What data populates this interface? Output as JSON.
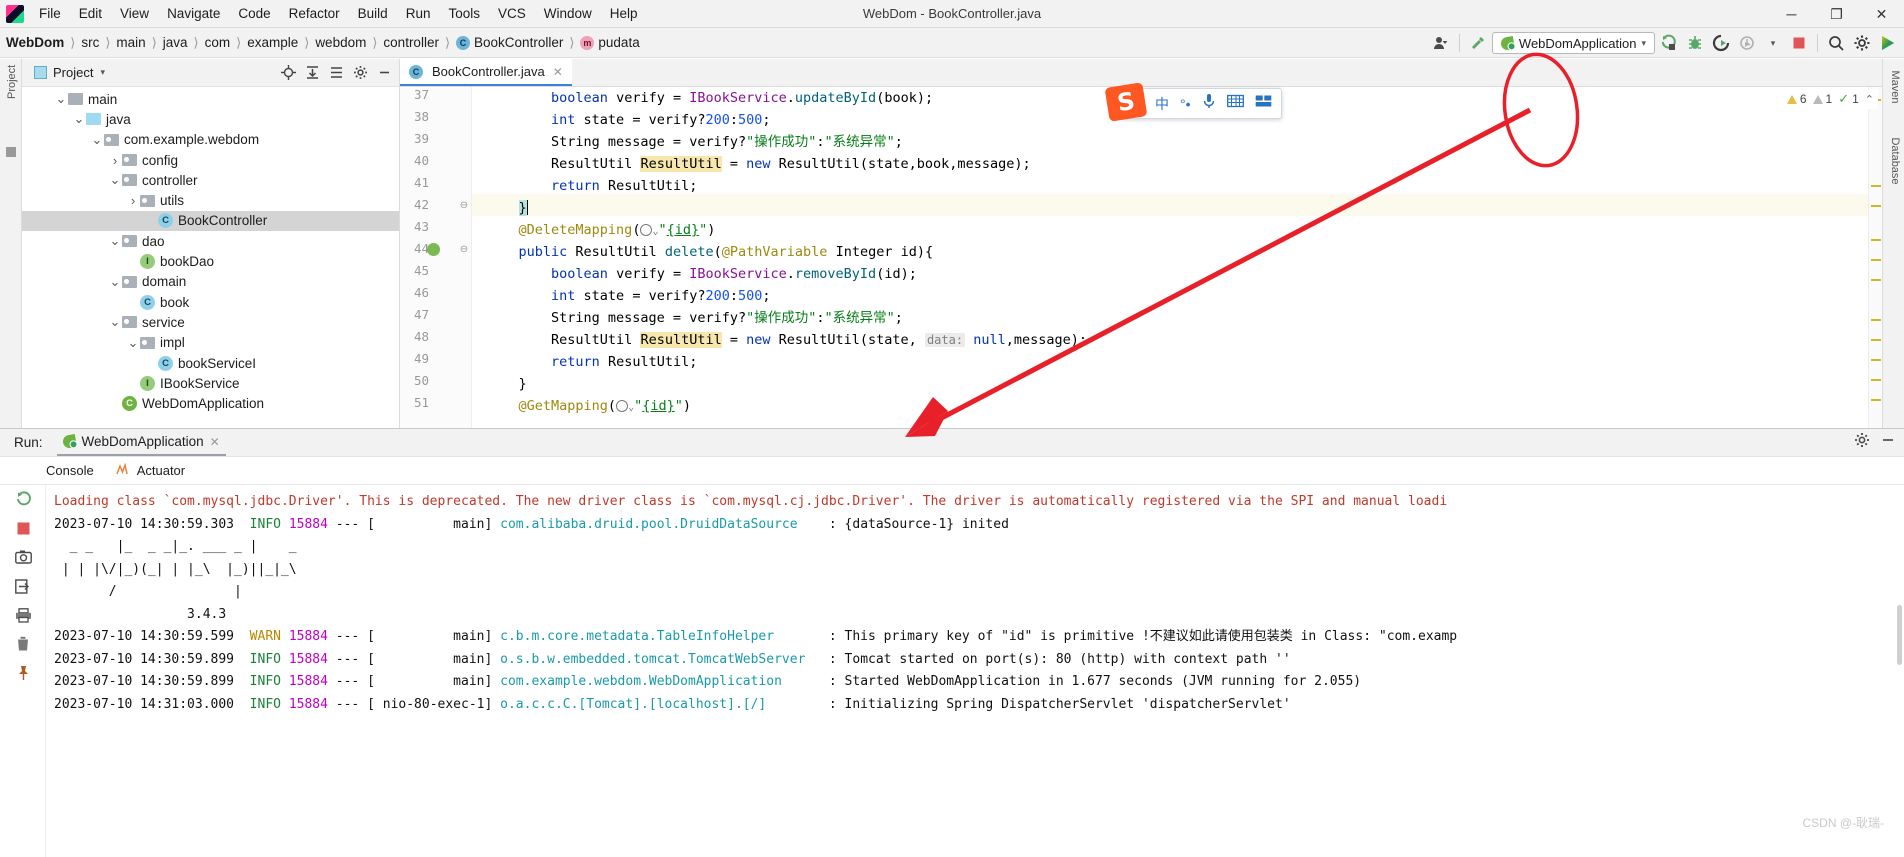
{
  "window": {
    "title": "WebDom - BookController.java",
    "app_icon": "intellij-idea-icon",
    "controls": {
      "minimize": "─",
      "maximize": "❐",
      "close": "✕"
    }
  },
  "menu": [
    "File",
    "Edit",
    "View",
    "Navigate",
    "Code",
    "Refactor",
    "Build",
    "Run",
    "Tools",
    "VCS",
    "Window",
    "Help"
  ],
  "breadcrumb": [
    {
      "label": "WebDom",
      "bold": true
    },
    {
      "label": "src"
    },
    {
      "label": "main"
    },
    {
      "label": "java"
    },
    {
      "label": "com"
    },
    {
      "label": "example"
    },
    {
      "label": "webdom"
    },
    {
      "label": "controller"
    },
    {
      "label": "BookController",
      "badge": "C"
    },
    {
      "label": "pudata",
      "badge": "m"
    }
  ],
  "toolbar": {
    "run_configuration": "WebDomApplication",
    "dropdown_caret": "▾",
    "icons": [
      "user-avatar-icon",
      "hammer-build-icon",
      "run-icon",
      "debug-icon",
      "run-coverage-icon",
      "profiler-icon",
      "stop-icon",
      "search-everywhere-icon",
      "settings-gear-icon",
      "updates-icon"
    ]
  },
  "project_panel": {
    "title": "Project",
    "caret": "▾",
    "tool_icons": [
      "locate-icon",
      "expand-all-icon",
      "collapse-all-icon",
      "settings-gear-icon",
      "hide-icon"
    ],
    "tree": [
      {
        "label": "main",
        "indent": 3,
        "arrow": "v",
        "icon": "folder-plain",
        "sel": false
      },
      {
        "label": "java",
        "indent": 4,
        "arrow": "v",
        "icon": "folder-blue",
        "sel": false
      },
      {
        "label": "com.example.webdom",
        "indent": 5,
        "arrow": "v",
        "icon": "folder-pkg",
        "sel": false
      },
      {
        "label": "config",
        "indent": 6,
        "arrow": ">",
        "icon": "folder-pkg",
        "sel": false
      },
      {
        "label": "controller",
        "indent": 6,
        "arrow": "v",
        "icon": "folder-pkg",
        "sel": false
      },
      {
        "label": "utils",
        "indent": 7,
        "arrow": ">",
        "icon": "folder-pkg",
        "sel": false
      },
      {
        "label": "BookController",
        "indent": 8,
        "arrow": "",
        "icon": "java-class",
        "sel": true
      },
      {
        "label": "dao",
        "indent": 6,
        "arrow": "v",
        "icon": "folder-pkg",
        "sel": false
      },
      {
        "label": "bookDao",
        "indent": 7,
        "arrow": "",
        "icon": "java-interface",
        "sel": false
      },
      {
        "label": "domain",
        "indent": 6,
        "arrow": "v",
        "icon": "folder-pkg",
        "sel": false
      },
      {
        "label": "book",
        "indent": 7,
        "arrow": "",
        "icon": "java-class",
        "sel": false
      },
      {
        "label": "service",
        "indent": 6,
        "arrow": "v",
        "icon": "folder-pkg",
        "sel": false
      },
      {
        "label": "impl",
        "indent": 7,
        "arrow": "v",
        "icon": "folder-pkg",
        "sel": false
      },
      {
        "label": "bookServiceI",
        "indent": 8,
        "arrow": "",
        "icon": "java-class",
        "sel": false
      },
      {
        "label": "IBookService",
        "indent": 7,
        "arrow": "",
        "icon": "java-interface",
        "sel": false
      },
      {
        "label": "WebDomApplication",
        "indent": 6,
        "arrow": "",
        "icon": "spring-class",
        "sel": false
      }
    ]
  },
  "editor": {
    "tab": {
      "label": "BookController.java",
      "icon": "java-class-icon",
      "close": "✕"
    },
    "inspection": {
      "warnings": "6",
      "weak_warnings": "1",
      "checks": "1",
      "caret": "⌃"
    },
    "lines": [
      {
        "n": "37"
      },
      {
        "n": "38"
      },
      {
        "n": "39"
      },
      {
        "n": "40"
      },
      {
        "n": "41"
      },
      {
        "n": "42"
      },
      {
        "n": "43"
      },
      {
        "n": "44"
      },
      {
        "n": "45"
      },
      {
        "n": "46"
      },
      {
        "n": "47"
      },
      {
        "n": "48"
      },
      {
        "n": "49"
      },
      {
        "n": "50"
      },
      {
        "n": "51"
      }
    ],
    "code_text": {
      "l37": "boolean verify = IBookService.updateById(book);",
      "l38": "int state = verify?200:500;",
      "l39": "String message = verify?\"操作成功\":\"系统异常\";",
      "l40": "ResultUtil ResultUtil = new ResultUtil(state,book,message);",
      "l41": "return ResultUtil;",
      "l42": "}",
      "l43": "@DeleteMapping(\"{id}\")",
      "l44": "public ResultUtil delete(@PathVariable Integer id){",
      "l45": "boolean verify = IBookService.removeById(id);",
      "l46": "int state = verify?200:500;",
      "l47": "String message = verify?\"操作成功\":\"系统异常\";",
      "l48": "ResultUtil ResultUtil = new ResultUtil(state, data: null,message);",
      "l49": "return ResultUtil;",
      "l50": "}",
      "l51": "@GetMapping(\"{id}\")"
    }
  },
  "ime": {
    "logo": "S",
    "items": [
      "中",
      "°•",
      "mic-icon",
      "keyboard-icon",
      "panel-icon"
    ]
  },
  "right_strips": {
    "maven": "Maven",
    "database": "Database"
  },
  "run_window": {
    "label": "Run:",
    "config_name": "WebDomApplication",
    "close": "✕",
    "header_icons": [
      "settings-gear-icon",
      "hide-icon"
    ],
    "subtabs": [
      {
        "label": "Console",
        "icon": "console-icon"
      },
      {
        "label": "Actuator",
        "icon": "actuator-icon"
      }
    ],
    "side_buttons": [
      "rerun-icon",
      "stop-icon",
      "camera-icon",
      "export-icon",
      "print-icon",
      "trash-icon",
      "pin-icon",
      "scroll-up-icon",
      "scroll-down-icon",
      "soft-wrap-icon",
      "scroll-end-icon"
    ],
    "console_lines": [
      {
        "kind": "warn-red",
        "text": "Loading class `com.mysql.jdbc.Driver'. This is deprecated. The new driver class is `com.mysql.cj.jdbc.Driver'. The driver is automatically registered via the SPI and manual loadi"
      },
      {
        "ts": "2023-07-10 14:30:59.303",
        "level": "INFO",
        "pid": "15884",
        "thread": "main",
        "logger": "com.alibaba.druid.pool.DruidDataSource",
        "msg": ": {dataSource-1} inited"
      },
      {
        "kind": "banner",
        "text": "  _ _   |_  _ _|_. ___ _ |    _"
      },
      {
        "kind": "banner",
        "text": " | | |\\/|_)(_| | |_\\  |_)||_|_\\"
      },
      {
        "kind": "banner",
        "text": "       /               |"
      },
      {
        "kind": "banner",
        "text": "                 3.4.3"
      },
      {
        "ts": "2023-07-10 14:30:59.599",
        "level": "WARN",
        "pid": "15884",
        "thread": "main",
        "logger": "c.b.m.core.metadata.TableInfoHelper",
        "msg": ": This primary key of \"id\" is primitive !不建议如此请使用包装类 in Class: \"com.examp"
      },
      {
        "ts": "2023-07-10 14:30:59.899",
        "level": "INFO",
        "pid": "15884",
        "thread": "main",
        "logger": "o.s.b.w.embedded.tomcat.TomcatWebServer",
        "msg": ": Tomcat started on port(s): 80 (http) with context path ''"
      },
      {
        "ts": "2023-07-10 14:30:59.899",
        "level": "INFO",
        "pid": "15884",
        "thread": "main",
        "logger": "com.example.webdom.WebDomApplication",
        "msg": ": Started WebDomApplication in 1.677 seconds (JVM running for 2.055)"
      },
      {
        "ts": "2023-07-10 14:31:03.000",
        "level": "INFO",
        "pid": "15884",
        "thread": "nio-80-exec-1",
        "logger": "o.a.c.c.C.[Tomcat].[localhost].[/]",
        "msg": ": Initializing Spring DispatcherServlet 'dispatcherServlet'"
      }
    ],
    "watermark": "CSDN @-耿瑞-"
  },
  "colors": {
    "accent_blue": "#3a84d8",
    "spring_green": "#6db33f",
    "warning_yellow": "#e8bc3f",
    "error_red": "#c0392b",
    "annotation_arrow": "#e8202a",
    "keyword": "#0033b3",
    "string": "#067d17",
    "annotation": "#9e880d",
    "static_field": "#871094",
    "number": "#1750eb"
  }
}
